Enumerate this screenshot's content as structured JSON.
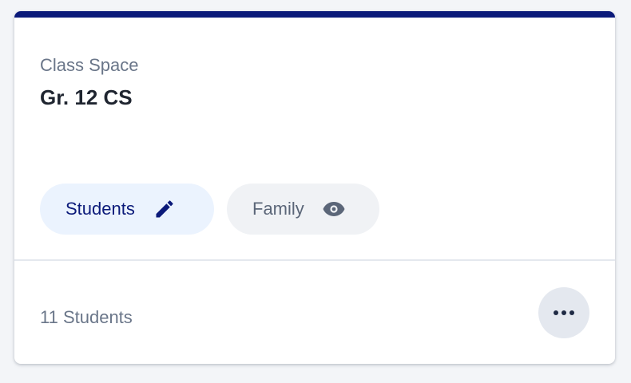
{
  "card": {
    "subtitle": "Class Space",
    "title": "Gr. 12 CS",
    "accent_color": "#0b1a7a",
    "chips": [
      {
        "label": "Students",
        "icon": "pencil-icon",
        "active": true
      },
      {
        "label": "Family",
        "icon": "eye-icon",
        "active": false
      }
    ],
    "footer": {
      "count_text": "11 Students",
      "more_icon": "ellipsis-icon"
    }
  }
}
